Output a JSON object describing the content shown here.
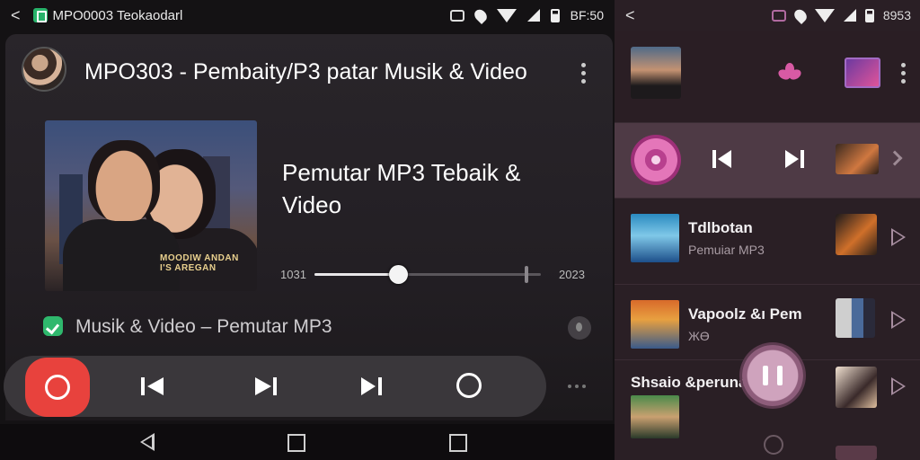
{
  "left": {
    "status": {
      "back": "<",
      "app_title": "MPO0003 Teokaodarl",
      "time": "BF:50"
    },
    "header": {
      "title": "MPO303 - Pembaity/P3 patar Musik & Video"
    },
    "now_playing": {
      "art_label": "MOODIW ANDAN\nI'S AREGAN",
      "title": "Pemutar MP3 Tebaik & Video",
      "time_left": "1031",
      "time_right": "2023",
      "progress_fraction": 0.37,
      "marker_fraction": 0.93
    },
    "source": {
      "text": "Musik & Video  –  Pemutar MP3"
    },
    "controls": {
      "prev_icon": "skip-prev",
      "next_icon": "skip-next",
      "next2_icon": "skip-next-bar"
    },
    "accent": "#e8423d"
  },
  "right": {
    "status": {
      "back": "<",
      "time": "8953"
    },
    "items": [
      {
        "title": "Tdlbotan",
        "subtitle": "Pemuiar MP3"
      },
      {
        "title": "Vapoolz &ı Pem",
        "subtitle": "ЖӨ"
      },
      {
        "title": "Shsaio &perunar",
        "subtitle": ""
      }
    ],
    "accent": "#b8408e"
  }
}
